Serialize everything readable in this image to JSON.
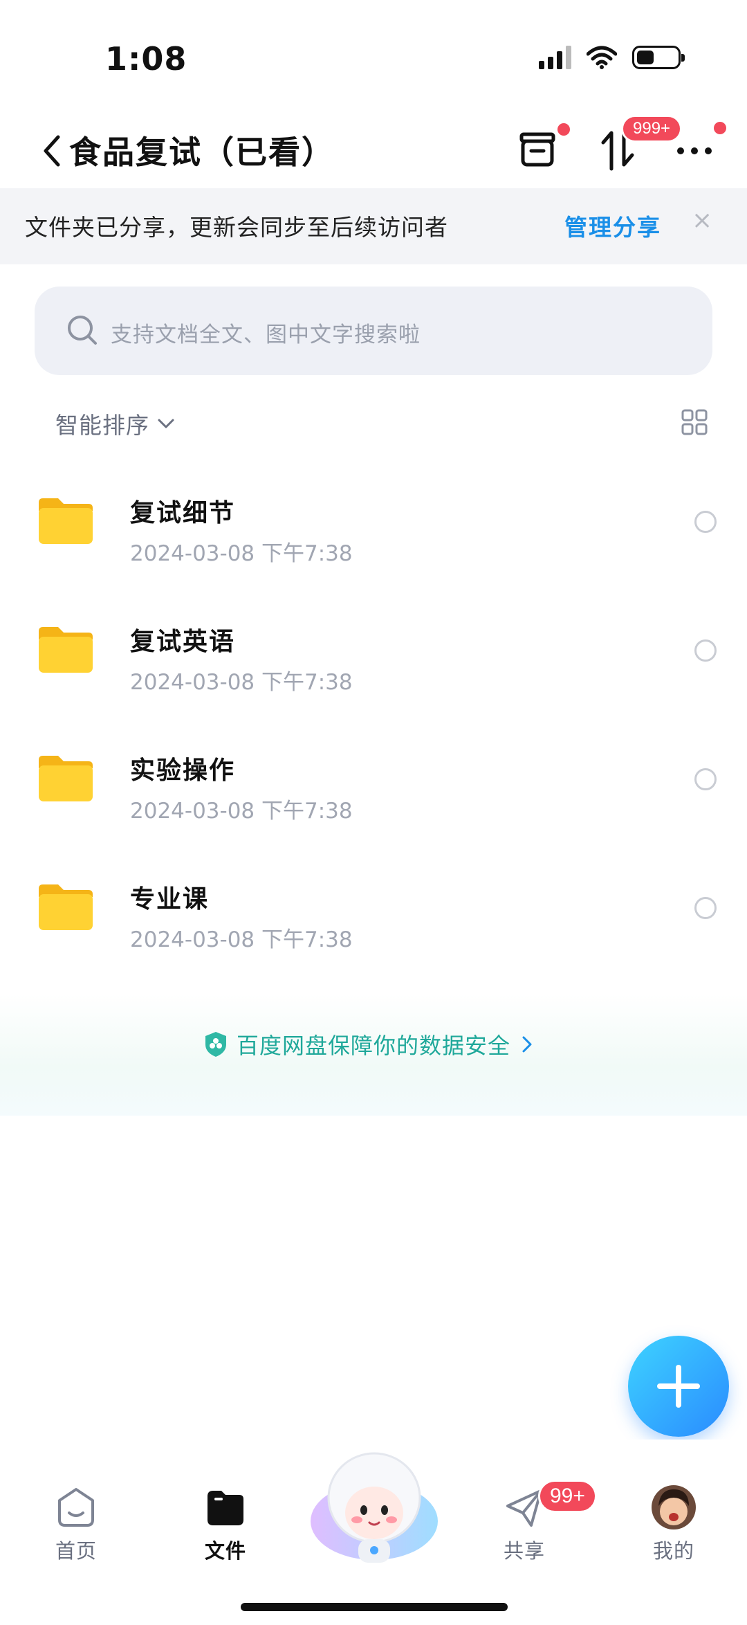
{
  "status_bar": {
    "time": "1:08"
  },
  "header": {
    "title": "食品复试（已看）",
    "transfer_badge": "999+"
  },
  "share_banner": {
    "text": "文件夹已分享，更新会同步至后续访问者",
    "link": "管理分享",
    "close": "×"
  },
  "search": {
    "placeholder": "支持文档全文、图中文字搜索啦"
  },
  "sort": {
    "label": "智能排序"
  },
  "files": [
    {
      "name": "复试细节",
      "date": "2024-03-08 下午7:38"
    },
    {
      "name": "复试英语",
      "date": "2024-03-08 下午7:38"
    },
    {
      "name": "实验操作",
      "date": "2024-03-08 下午7:38"
    },
    {
      "name": "专业课",
      "date": "2024-03-08 下午7:38"
    }
  ],
  "security": {
    "text": "百度网盘保障你的数据安全"
  },
  "tabbar": {
    "tabs": [
      {
        "label": "首页"
      },
      {
        "label": "文件"
      },
      {
        "label": "共享"
      },
      {
        "label": "我的"
      }
    ],
    "share_badge": "99+"
  },
  "colors": {
    "accent": "#1a8fe8",
    "badge": "#f2495a",
    "folder": "#ffc928",
    "security_text": "#1fa89a"
  },
  "icons": {
    "header": [
      "chevron-left-icon",
      "recycle-box-icon",
      "transfer-icon",
      "more-icon"
    ],
    "tabbar": [
      "home-icon",
      "folder-icon",
      "send-icon",
      "avatar"
    ]
  }
}
